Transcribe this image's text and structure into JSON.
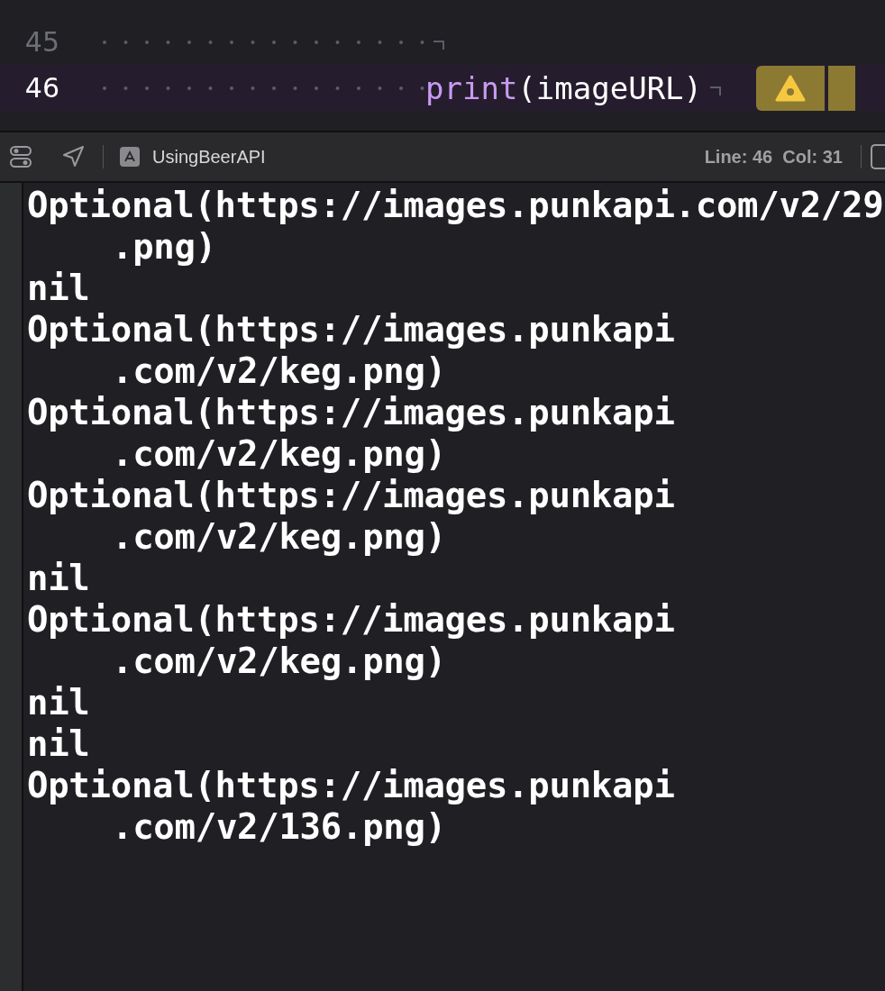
{
  "editor": {
    "lines": [
      {
        "number": "45",
        "kind": "blank",
        "current": false,
        "warning": false
      },
      {
        "number": "46",
        "code": "print(imageURL)",
        "kind": "call",
        "current": true,
        "warning": true
      }
    ]
  },
  "status_bar": {
    "scheme": "UsingBeerAPI",
    "position": "Line: 46  Col: 31"
  },
  "console": {
    "entries": [
      {
        "text": "Optional(https://images.punkapi.com/v2/29",
        "wrap": ".png)"
      },
      {
        "text": "nil"
      },
      {
        "text": "Optional(https://images.punkapi",
        "wrap": ".com/v2/keg.png)"
      },
      {
        "text": "Optional(https://images.punkapi",
        "wrap": ".com/v2/keg.png)"
      },
      {
        "text": "Optional(https://images.punkapi",
        "wrap": ".com/v2/keg.png)"
      },
      {
        "text": "nil"
      },
      {
        "text": "Optional(https://images.punkapi",
        "wrap": ".com/v2/keg.png)"
      },
      {
        "text": "nil"
      },
      {
        "text": "nil"
      },
      {
        "text": "Optional(https://images.punkapi",
        "wrap": ".com/v2/136.png)"
      }
    ]
  }
}
